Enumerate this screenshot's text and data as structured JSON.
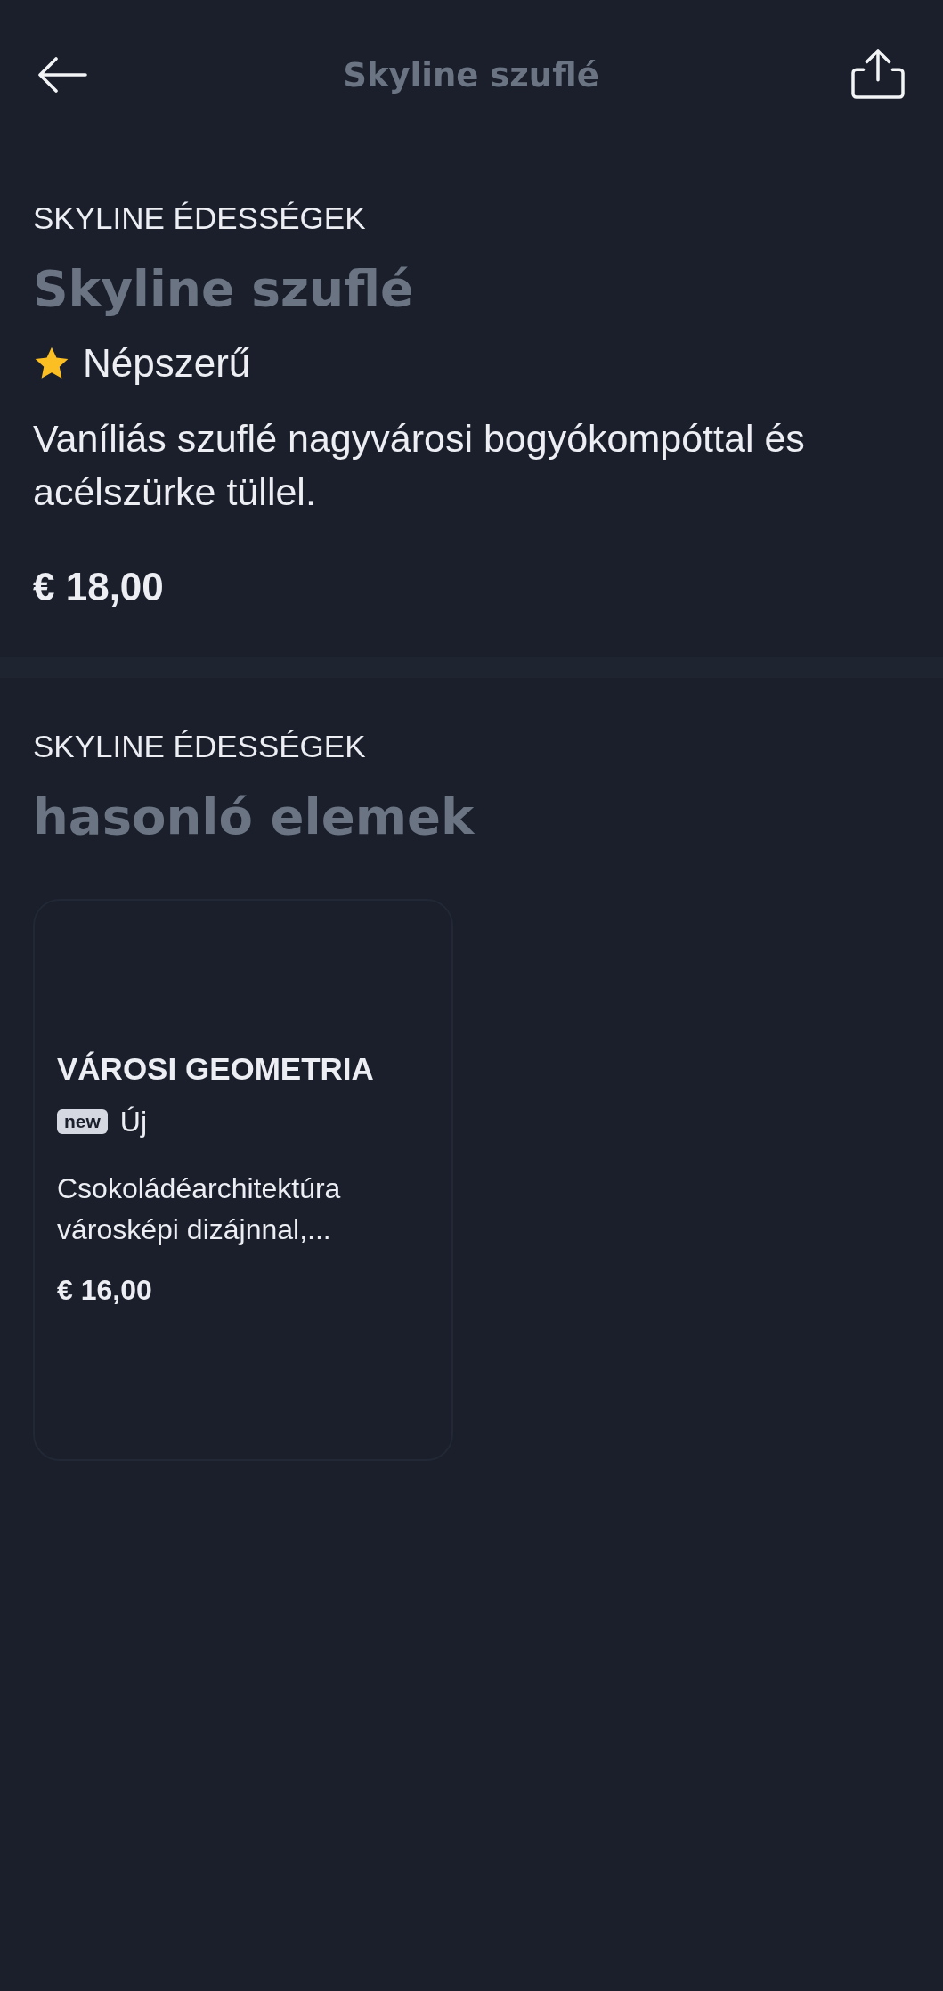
{
  "top_bar": {
    "title": "Skyline szuflé"
  },
  "product": {
    "category": "SKYLINE ÉDESSÉGEK",
    "name": "Skyline szuflé",
    "tag": {
      "kind": "star",
      "label": "Népszerű"
    },
    "description": "Vaníliás szuflé nagyvárosi bogyókompóttal és acélszürke tüllel.",
    "price": "€ 18,00"
  },
  "similar": {
    "category": "SKYLINE ÉDESSÉGEK",
    "title": "hasonló elemek",
    "items": [
      {
        "name": "VÁROSI GEOMETRIA",
        "tag": {
          "kind": "badge",
          "badge": "new",
          "label": "Új"
        },
        "description": "Csokoládéarchitektúra városképi dizájnnal,...",
        "price": "€ 16,00"
      }
    ]
  }
}
